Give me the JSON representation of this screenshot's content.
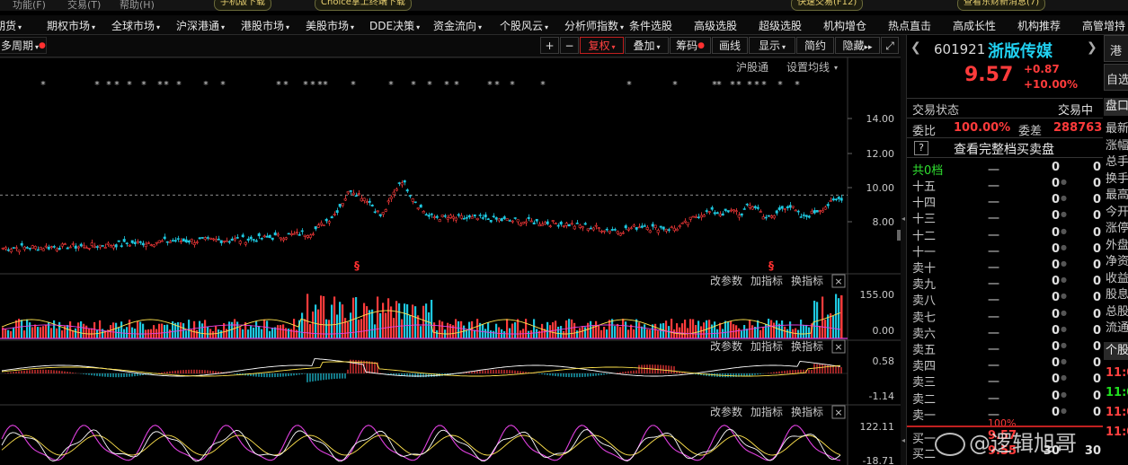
{
  "top_strip": {
    "items": [
      "功能(F)",
      "交易(T)",
      "帮助(H)"
    ],
    "pills": [
      "手机版下载",
      "Choice掌上终端下载",
      "快速交易(F12)",
      "查看东财新消息(7)"
    ]
  },
  "menu": {
    "items": [
      "期货",
      "期权市场",
      "全球市场",
      "沪深港通",
      "港股市场",
      "美股市场",
      "DDE决策",
      "资金流向",
      "个股风云",
      "分析师指数",
      "条件选股",
      "高级选股",
      "超级选股",
      "机构增仓",
      "热点直击",
      "高成长性",
      "机构推荐",
      "高管增持"
    ]
  },
  "toolbar": {
    "period_label": "多周期",
    "plus": "+",
    "minus": "−",
    "restore_label": "复权",
    "overlay_label": "叠加",
    "chip_label": "筹码",
    "draw_label": "画线",
    "display_label": "显示",
    "simple_label": "简约",
    "hide_label": "隐藏",
    "hide_arrows": "▸▸",
    "fullscreen": "⤢"
  },
  "chart": {
    "top_links": [
      "沪股通",
      "设置均线"
    ],
    "price_ticks": [
      "14.00",
      "12.00",
      "10.00",
      "8.00"
    ],
    "vol_ticks": [
      "155.00",
      "0.00"
    ],
    "macd_ticks": [
      "0.58",
      "-1.14"
    ],
    "kdj_ticks": [
      "122.11",
      "-18.71"
    ],
    "panel_actions": [
      "改参数",
      "加指标",
      "换指标"
    ],
    "close_glyph": "×",
    "marker_glyph": "§",
    "star_glyph": "*"
  },
  "stock": {
    "code": "601921",
    "name": "浙版传媒",
    "price": "9.57",
    "change": "+0.87",
    "change_pct": "+10.00%",
    "nav_left": "❮",
    "nav_right": "❯",
    "status_label": "交易状态",
    "status_value": "交易中",
    "ratio_label": "委比",
    "ratio_value": "100.00%",
    "diff_label": "委差",
    "diff_value": "288763",
    "help_icon": "?",
    "full_book_label": "查看完整档买卖盘",
    "total_levels": "共0档"
  },
  "order_book": {
    "dash": "一",
    "asks": [
      {
        "label": "十五",
        "v1": "0",
        "v2": "0"
      },
      {
        "label": "十四",
        "v1": "0",
        "v2": "0"
      },
      {
        "label": "十三",
        "v1": "0",
        "v2": "0"
      },
      {
        "label": "十二",
        "v1": "0",
        "v2": "0"
      },
      {
        "label": "十一",
        "v1": "0",
        "v2": "0"
      },
      {
        "label": "卖十",
        "v1": "0",
        "v2": "0"
      },
      {
        "label": "卖九",
        "v1": "0",
        "v2": "0"
      },
      {
        "label": "卖八",
        "v1": "0",
        "v2": "0"
      },
      {
        "label": "卖七",
        "v1": "0",
        "v2": "0"
      },
      {
        "label": "卖六",
        "v1": "0",
        "v2": "0"
      },
      {
        "label": "卖五",
        "v1": "0",
        "v2": "0"
      },
      {
        "label": "卖四",
        "v1": "0",
        "v2": "0"
      },
      {
        "label": "卖三",
        "v1": "0",
        "v2": "0"
      },
      {
        "label": "卖二",
        "v1": "0",
        "v2": "0"
      },
      {
        "label": "卖一",
        "v1": "0",
        "v2": "0"
      }
    ],
    "total_v1": "0",
    "total_v2": "0",
    "bid_pct": "100%",
    "bids": [
      {
        "label": "买一",
        "price": "9.57",
        "v1": "",
        "v2": ""
      },
      {
        "label": "买二",
        "price": "9.55",
        "v1": "30",
        "v2": "30"
      }
    ]
  },
  "side_tabs": {
    "header_a": "港",
    "header_b": "自选",
    "panel": "盘口",
    "items": [
      "最新",
      "涨幅",
      "总手",
      "换手",
      "最高",
      "今开",
      "涨停",
      "外盘",
      "净资",
      "收益",
      "股息",
      "总股",
      "流通"
    ],
    "ticker_header": "个股",
    "ticker_times": [
      "11:0",
      "11:0",
      "11:0",
      "11:0"
    ],
    "ticker_colors": [
      "#ff4040",
      "#20e020",
      "#ff4040",
      "#ff4040"
    ]
  },
  "watermark": "@逻辑旭哥",
  "colors": {
    "up": "#ff3b3b",
    "down": "#1ec8e0",
    "yellow": "#ffe34d",
    "magenta": "#e040e0",
    "accent_name": "#20d0f0"
  }
}
